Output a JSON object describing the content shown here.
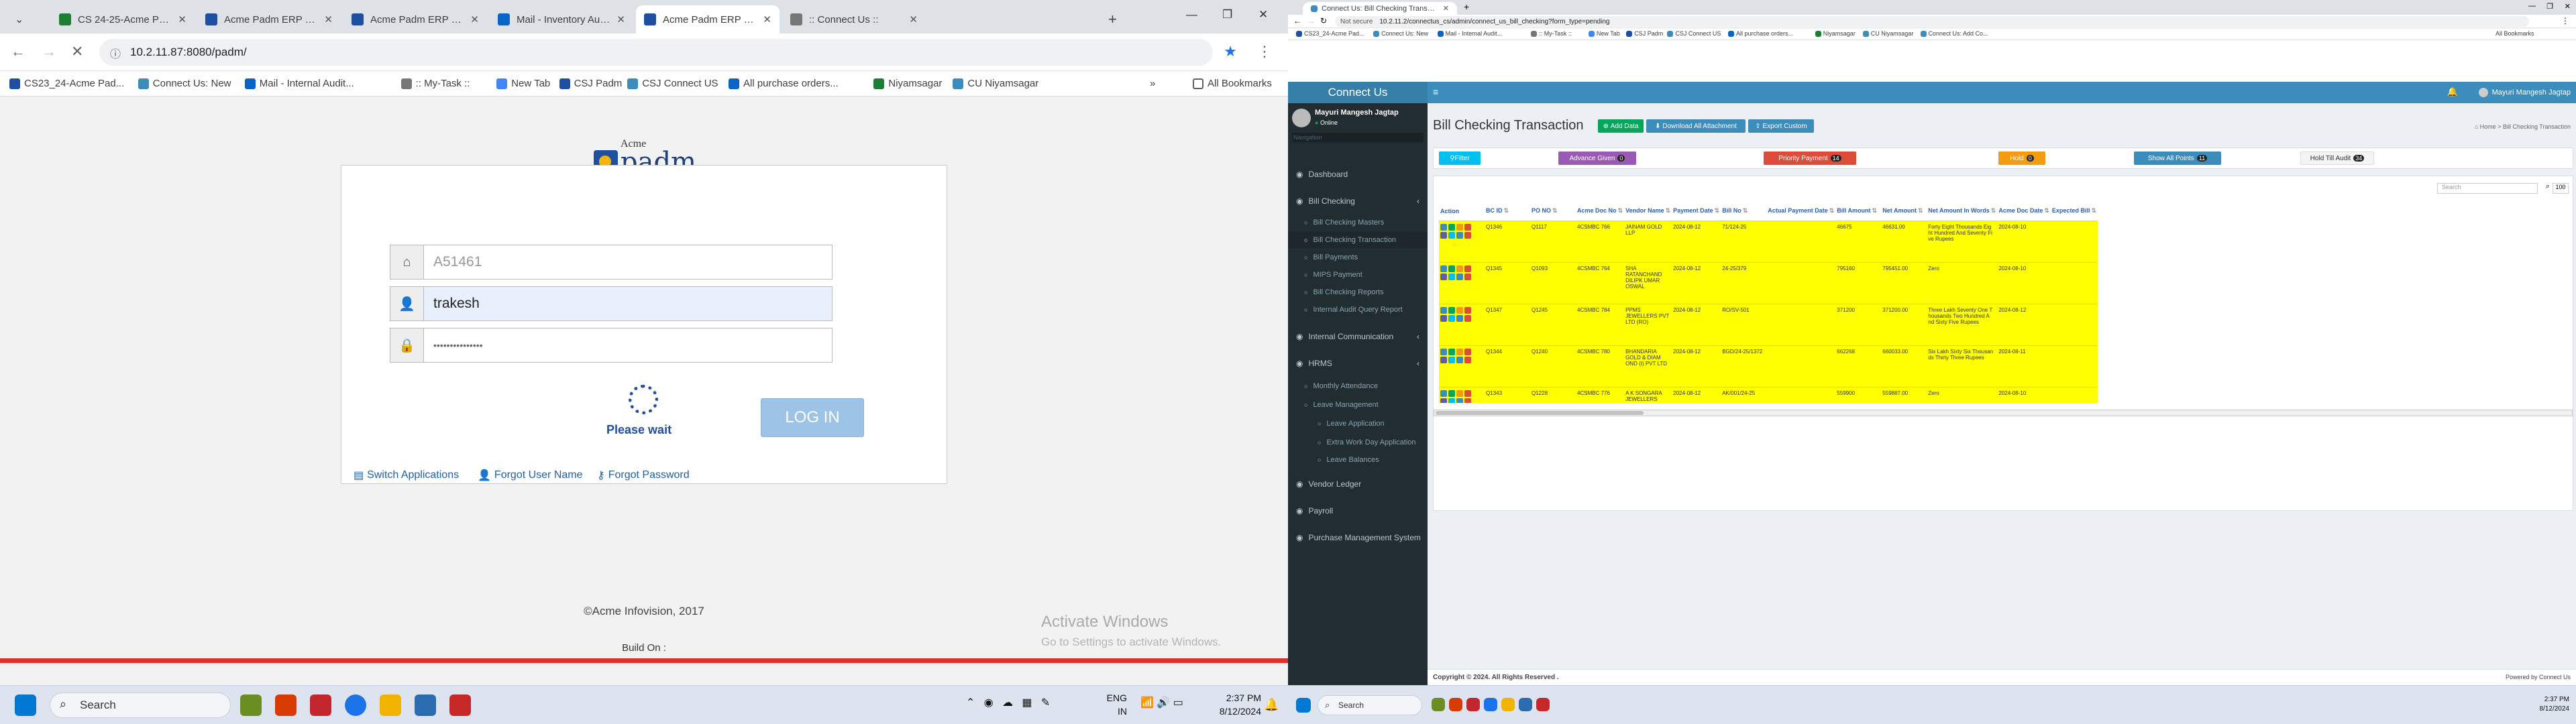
{
  "left": {
    "tabs": [
      {
        "label": "CS 24-25-Acme Padm ERP",
        "color": "#1e7e34"
      },
      {
        "label": "Acme Padm ERP Platform",
        "color": "#1f4fa0"
      },
      {
        "label": "Acme Padm ERP Platform",
        "color": "#1f4fa0"
      },
      {
        "label": "Mail - Inventory Audit - Ou",
        "color": "#0a64c8"
      },
      {
        "label": "Acme Padm ERP Platform",
        "color": "#1f4fa0"
      },
      {
        "label": ":: Connect Us ::",
        "color": "#777777"
      }
    ],
    "url": "10.2.11.87:8080/padm/",
    "bookmarks": [
      "CS23_24-Acme Pad...",
      "Connect Us: New",
      "Mail - Internal Audit...",
      ":: My-Task ::",
      "New Tab",
      "CSJ Padm",
      "CSJ Connect US",
      "All purchase orders...",
      "Niyamsagar",
      "CU Niyamsagar"
    ],
    "all_bookmarks": "All Bookmarks",
    "logo": {
      "small": "Acme",
      "big": "padm"
    },
    "login": {
      "user_id": "A51461",
      "username": "trakesh",
      "password": "•••••••••••••••",
      "button": "LOG IN",
      "wait": "Please wait",
      "links": [
        "Switch Applications",
        "Forgot User Name",
        "Forgot Password"
      ]
    },
    "copyright": "©Acme Infovision, 2017",
    "build": "Build On :",
    "watermark": {
      "title": "Activate Windows",
      "sub": "Go to Settings to activate Windows."
    },
    "taskbar": {
      "search": "Search",
      "lang1": "ENG",
      "lang2": "IN",
      "time": "2:37 PM",
      "date": "8/12/2024"
    }
  },
  "right": {
    "tab": "Connect Us: Bill Checking Transac...",
    "not_secure": "Not secure",
    "url": "10.2.11.2/connectus_cs/admin/connect_us_bill_checking?form_type=pending",
    "bookmarks": [
      "CS23_24-Acme Pad...",
      "Connect Us: New",
      "Mail - Internal Audit...",
      ":: My-Task ::",
      "New Tab",
      "CSJ Padm",
      "CSJ Connect US",
      "All purchase orders...",
      "Niyamsagar",
      "CU Niyamsagar",
      "Connect Us: Add Co..."
    ],
    "all_bookmarks": "All Bookmarks",
    "brand": "Connect Us",
    "user": {
      "name": "Mayuri Mangesh Jagtap",
      "status": "Online"
    },
    "navigation": "Navigation",
    "menu": [
      "Dashboard",
      "Bill Checking",
      "Bill Checking Masters",
      "Bill Checking Transaction",
      "Bill Payments",
      "MIPS Payment",
      "Bill Checking Reports",
      "Internal Audit Query Report",
      "Internal Communication",
      "HRMS",
      "Monthly Attendance",
      "Leave Management",
      "Leave Application",
      "Extra Work Day Application",
      "Leave Balances",
      "Vendor Ledger",
      "Payroll",
      "Purchase Management System"
    ],
    "page_title": "Bill Checking Transaction",
    "buttons": {
      "add": "Add Data",
      "download": "Download All Attachment",
      "export": "Export Custom"
    },
    "crumb": {
      "home": "Home",
      "current": "Bill Checking Transaction"
    },
    "filters": [
      {
        "label": "Filter",
        "count": "",
        "color": "#00c0ef"
      },
      {
        "label": "Advance Given",
        "count": "0",
        "color": "#9b59b6"
      },
      {
        "label": "Priority Payment",
        "count": "14",
        "color": "#dd4b39"
      },
      {
        "label": "Hold",
        "count": "0",
        "color": "#f39c12"
      },
      {
        "label": "Show All Points",
        "count": "11",
        "color": "#3c8dbc"
      },
      {
        "label": "Hold Till Audit",
        "count": "34",
        "color": "#f4f4f4"
      }
    ],
    "search_placeholder": "Search",
    "page_size": "100",
    "columns": [
      "Action",
      "BC ID",
      "PO NO",
      "Acme Doc No",
      "Vendor Name",
      "Payment Date",
      "Bill No",
      "Actual Payment Date",
      "Bill Amount",
      "Net Amount",
      "Net Amount In Words",
      "Acme Doc Date",
      "Expected Bill"
    ],
    "rows": [
      [
        "",
        "Q1346",
        "Q1117",
        "4CSMBC 766",
        "JAINAM GOLD LLP",
        "2024-08-12",
        "71/124-25",
        "",
        "46675",
        "46631.00",
        "Forty Eight Thousands Eig ht Hundred And Seventy Fi ve Rupees",
        "2024-08-10",
        ""
      ],
      [
        "",
        "Q1345",
        "Q1093",
        "4CSMBC 764",
        "SHA RATANCHAND DILIPK UMAR OSWAL",
        "2024-08-12",
        "24-25/379",
        "",
        "795160",
        "795451.00",
        "Zero",
        "2024-08-10",
        ""
      ],
      [
        "",
        "Q1347",
        "Q1245",
        "4CSMBC 784",
        "PPMS JEWELLERS PVT LTD (RO)",
        "2024-08-12",
        "RO/SV-501",
        "",
        "371200",
        "371200.00",
        "Three Lakh Seventy One T housands Two Hundred A nd Sixty Five Rupees",
        "2024-08-12",
        ""
      ],
      [
        "",
        "Q1344",
        "Q1240",
        "4CSMBC 780",
        "BHANDARIA GOLD & DIAM OND (I) PVT LTD",
        "2024-08-12",
        "BGD/24-25/1372",
        "",
        "662268",
        "660033.00",
        "Six Lakh Sixty Six Thousan ds Thirty Three Rupees",
        "2024-08-11",
        ""
      ],
      [
        "",
        "Q1343",
        "Q1228",
        "4CSMBC 776",
        "A K SONGARA JEWELLERS",
        "2024-08-12",
        "AK/001/24-25",
        "",
        "559900",
        "559887.00",
        "Zero",
        "2024-08-10",
        ""
      ]
    ],
    "footer": {
      "copy": "Copyright © 2024. All Rights Reserved .",
      "powered": "Powered by Connect Us"
    },
    "taskbar": {
      "search": "Search",
      "time": "2:37 PM",
      "date": "8/12/2024"
    }
  }
}
